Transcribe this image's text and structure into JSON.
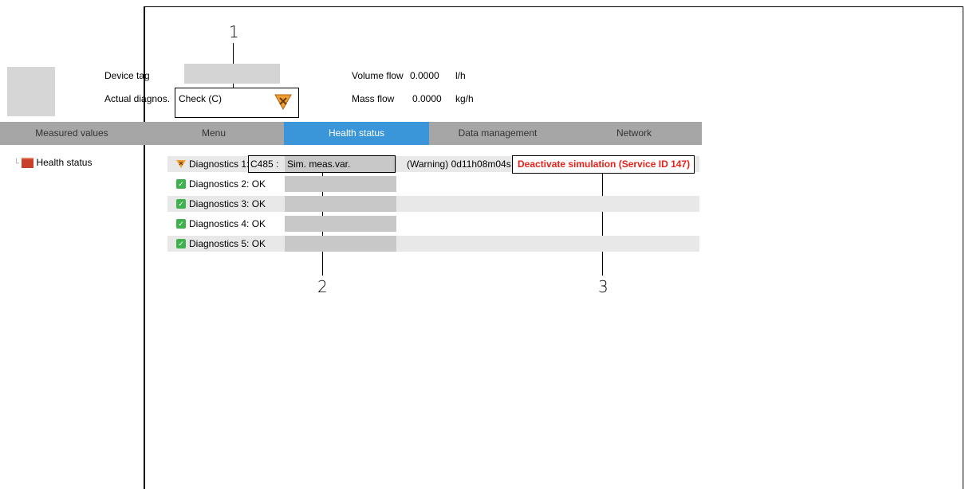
{
  "callouts": [
    "1",
    "2",
    "3"
  ],
  "header": {
    "device_tag_label": "Device tag",
    "actual_diag_label": "Actual diagnos.",
    "actual_diag_value": "Check (C)",
    "volume_flow_label": "Volume flow",
    "volume_flow_value": "0.0000",
    "volume_flow_unit": "l/h",
    "mass_flow_label": "Mass flow",
    "mass_flow_value": "0.0000",
    "mass_flow_unit": "kg/h"
  },
  "nav": {
    "tabs": [
      "Measured values",
      "Menu",
      "Health status",
      "Data management",
      "Network"
    ],
    "active": "Health status"
  },
  "tree": {
    "root_label": "Health status"
  },
  "diagnostics": [
    {
      "label": "Diagnostics 1:",
      "code": "C485 :",
      "text": "Sim. meas.var.",
      "status": "warning"
    },
    {
      "label": "Diagnostics 2: OK",
      "status": "ok"
    },
    {
      "label": "Diagnostics 3: OK",
      "status": "ok"
    },
    {
      "label": "Diagnostics 4: OK",
      "status": "ok"
    },
    {
      "label": "Diagnostics 5: OK",
      "status": "ok"
    }
  ],
  "diag1_time": "(Warning) 0d11h08m04s",
  "remedy": "Deactivate simulation (Service ID 147)",
  "colors": {
    "accent": "#3a96d8",
    "nav_bg": "#a6a6a6",
    "ok": "#3fb24e",
    "remedy": "#e8211a",
    "warning_icon": "#f0a030"
  }
}
